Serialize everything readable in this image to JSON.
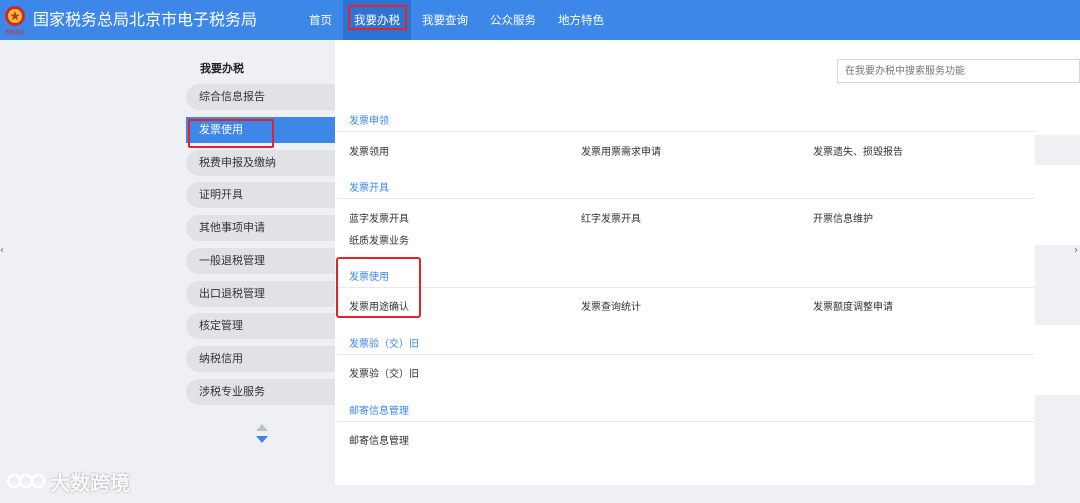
{
  "header": {
    "site_title": "国家税务总局北京市电子税务局",
    "emblem_caption": "国家税务",
    "nav": [
      "首页",
      "我要办税",
      "我要查询",
      "公众服务",
      "地方特色"
    ]
  },
  "sidebar": {
    "title": "我要办税",
    "items": [
      "综合信息报告",
      "发票使用",
      "税费申报及缴纳",
      "证明开具",
      "其他事项申请",
      "一般退税管理",
      "出口退税管理",
      "核定管理",
      "纳税信用",
      "涉税专业服务"
    ]
  },
  "search": {
    "placeholder": "在我要办税中搜索服务功能"
  },
  "sections": [
    {
      "title": "发票申领",
      "services": [
        "发票领用",
        "发票用票需求申请",
        "发票遗失、损毁报告"
      ]
    },
    {
      "title": "发票开具",
      "services": [
        "蓝字发票开具",
        "红字发票开具",
        "开票信息维护",
        "纸质发票业务"
      ]
    },
    {
      "title": "发票使用",
      "services": [
        "发票用途确认",
        "发票查询统计",
        "发票额度调整申请"
      ]
    },
    {
      "title": "发票验（交）旧",
      "services": [
        "发票验（交）旧"
      ]
    },
    {
      "title": "邮寄信息管理",
      "services": [
        "邮寄信息管理"
      ]
    }
  ],
  "watermark": "大数跨境",
  "colors": {
    "primary": "#3c87e8",
    "highlight": "#e0242a",
    "nav_active": "#2e72d2"
  }
}
